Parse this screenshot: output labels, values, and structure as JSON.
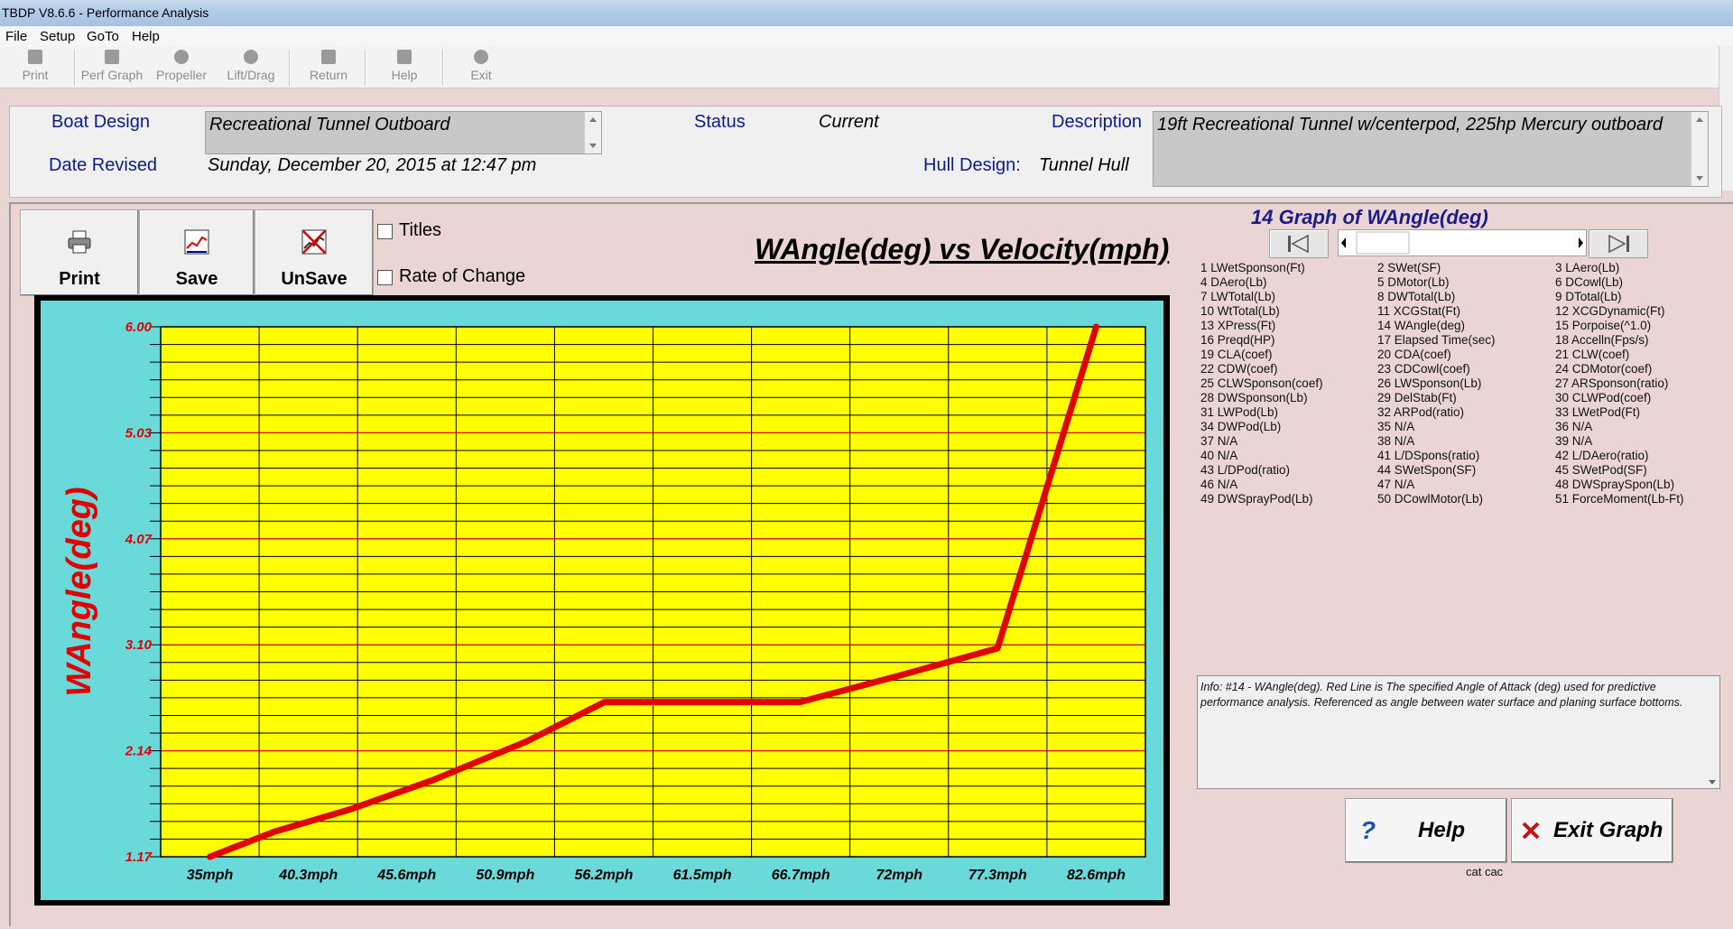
{
  "window": {
    "title": "TBDP V8.6.6 - Performance Analysis"
  },
  "menu": [
    "File",
    "Setup",
    "GoTo",
    "Help"
  ],
  "toolbar": [
    {
      "label": "Print",
      "icon": "printer-icon"
    },
    {
      "label": "Perf Graph",
      "icon": "graph-icon"
    },
    {
      "label": "Propeller",
      "icon": "propeller-icon"
    },
    {
      "label": "Lift/Drag",
      "icon": "liftdrag-icon"
    },
    {
      "label": "Return",
      "icon": "return-arrow-icon"
    },
    {
      "label": "Help",
      "icon": "help-icon"
    },
    {
      "label": "Exit",
      "icon": "exit-icon"
    }
  ],
  "info": {
    "boat_design_label": "Boat Design",
    "boat_design_value": "Recreational Tunnel Outboard",
    "date_revised_label": "Date Revised",
    "date_revised_value": "Sunday, December 20, 2015 at 12:47 pm",
    "status_label": "Status",
    "status_value": "Current",
    "description_label": "Description",
    "description_value": "19ft Recreational Tunnel w/centerpod, 225hp Mercury outboard",
    "hull_design_label": "Hull Design:",
    "hull_design_value": "Tunnel Hull"
  },
  "graph_buttons": {
    "print": "Print",
    "save": "Save",
    "unsave": "UnSave"
  },
  "options": {
    "titles": "Titles",
    "rate_of_change": "Rate of Change"
  },
  "chart_title": "WAngle(deg) vs Velocity(mph)",
  "chart_data": {
    "type": "line",
    "ylabel": "WAngle(deg)",
    "xlabel": "",
    "y_ticks": [
      "6.00",
      "5.03",
      "4.07",
      "3.10",
      "2.14",
      "1.17"
    ],
    "ylim": [
      1.17,
      6.0
    ],
    "categories": [
      "35mph",
      "40.3mph",
      "45.6mph",
      "50.9mph",
      "56.2mph",
      "61.5mph",
      "66.7mph",
      "72mph",
      "77.3mph",
      "82.6mph"
    ],
    "x": [
      35,
      40.3,
      45.6,
      50.9,
      56.2,
      61.5,
      66.7,
      72,
      77.3,
      82.6
    ],
    "series": [
      {
        "color": "#e00000",
        "x": [
          35,
          38.5,
          42.5,
          47,
          52,
          56.2,
          61.5,
          66.7,
          72,
          77.3,
          82.6
        ],
        "y": [
          1.17,
          1.4,
          1.6,
          1.87,
          2.22,
          2.58,
          2.58,
          2.58,
          2.82,
          3.07,
          6.0
        ]
      }
    ],
    "colors": {
      "plot_bg": "#ffff00",
      "frame_bg": "#6ad9d9",
      "grid": "#000000",
      "major_grid": "#ff0000",
      "line": "#e00000"
    }
  },
  "right_panel": {
    "graph_title": "14 Graph of WAngle(deg)",
    "variables": [
      "1 LWetSponson(Ft)",
      "2 SWet(SF)",
      "3 LAero(Lb)",
      "4 DAero(Lb)",
      "5 DMotor(Lb)",
      "6 DCowl(Lb)",
      "7 LWTotal(Lb)",
      "8 DWTotal(Lb)",
      "9 DTotal(Lb)",
      "10 WtTotal(Lb)",
      "11 XCGStat(Ft)",
      "12 XCGDynamic(Ft)",
      "13 XPress(Ft)",
      "14 WAngle(deg)",
      "15 Porpoise(^1.0)",
      "16 Preqd(HP)",
      "17 Elapsed Time(sec)",
      "18 Accelln(Fps/s)",
      "19 CLA(coef)",
      "20 CDA(coef)",
      "21 CLW(coef)",
      "22 CDW(coef)",
      "23 CDCowl(coef)",
      "24 CDMotor(coef)",
      "25 CLWSponson(coef)",
      "26 LWSponson(Lb)",
      "27 ARSponson(ratio)",
      "28 DWSponson(Lb)",
      "29 DelStab(Ft)",
      "30 CLWPod(coef)",
      "31 LWPod(Lb)",
      "32 ARPod(ratio)",
      "33 LWetPod(Ft)",
      "34 DWPod(Lb)",
      "35 N/A",
      "36 N/A",
      "37 N/A",
      "38 N/A",
      "39 N/A",
      "40 N/A",
      "41 L/DSpons(ratio)",
      "42 L/DAero(ratio)",
      "43 L/DPod(ratio)",
      "44 SWetSpon(SF)",
      "45 SWetPod(SF)",
      "46 N/A",
      "47 N/A",
      "48 DWSpraySpon(Lb)",
      "49 DWSprayPod(Lb)",
      "50 DCowlMotor(Lb)",
      "51 ForceMoment(Lb-Ft)"
    ],
    "info_text": "Info: #14 - WAngle(deg). Red Line is The specified Angle of Attack (deg) used for predictive performance analysis.  Referenced as angle between water surface and planing surface bottoms.",
    "help_button": "Help",
    "exit_button": "Exit Graph",
    "footnote": "cat cac"
  }
}
